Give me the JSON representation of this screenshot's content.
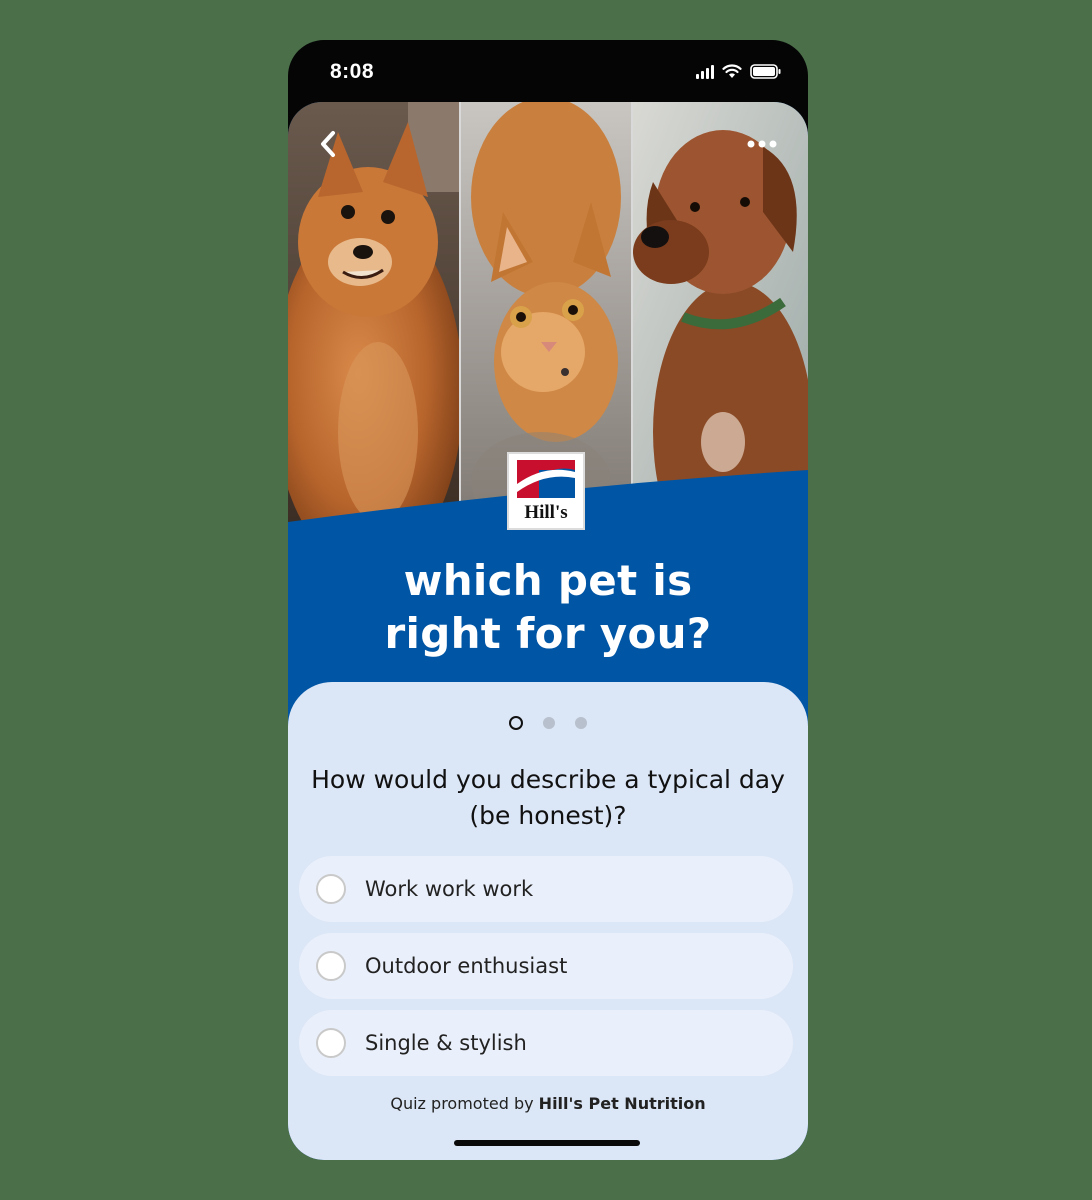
{
  "status_bar": {
    "time": "8:08"
  },
  "nav": {
    "back_icon": "chevron-left-icon",
    "more_icon": "more-horizontal-icon"
  },
  "hero": {
    "images": [
      "pomeranian-dog-photo",
      "orange-cat-photo",
      "brown-dog-photo"
    ],
    "logo_text": "Hill's"
  },
  "headline": {
    "line1": "which pet is",
    "line2": "right for you?"
  },
  "quiz": {
    "progress": {
      "current": 1,
      "total": 3
    },
    "question_line1": "How would you describe a typical day",
    "question_line2": "(be honest)?",
    "options": [
      {
        "label": "Work work work"
      },
      {
        "label": "Outdoor enthusiast"
      },
      {
        "label": "Single & stylish"
      }
    ],
    "footer_prefix": "Quiz promoted by",
    "footer_brand": "Hill's Pet Nutrition"
  },
  "colors": {
    "brand_blue": "#0055a4",
    "card_bg": "#dbe6f6",
    "logo_red": "#c8102e",
    "background": "#4a6f49"
  }
}
